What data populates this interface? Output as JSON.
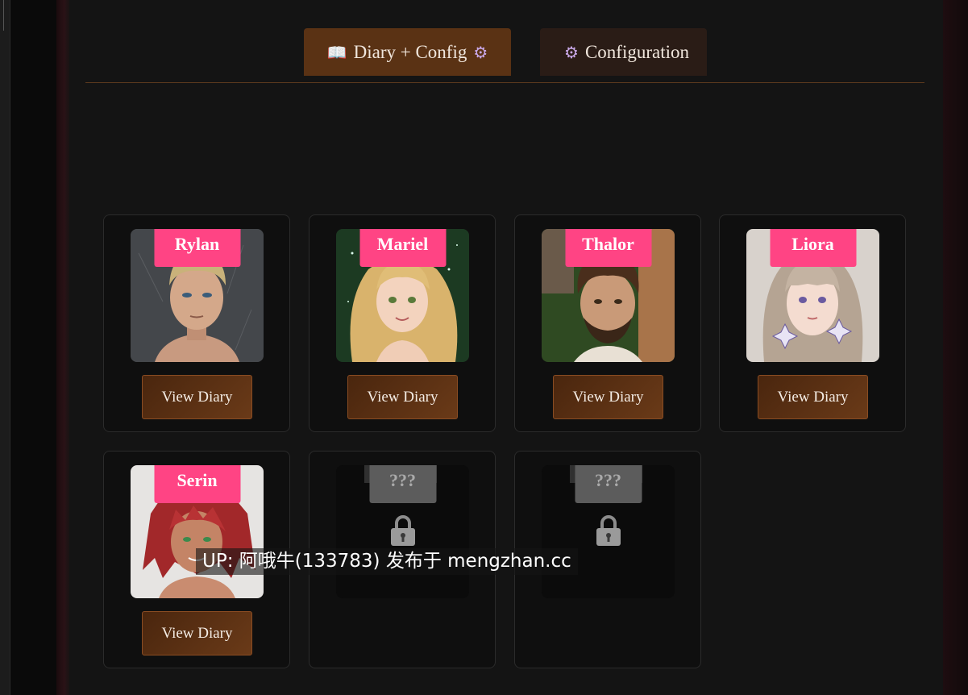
{
  "tabs": {
    "diary": {
      "icon_left": "📖",
      "label": "Diary + Config",
      "icon_right": "⚙",
      "active": true
    },
    "config": {
      "icon": "⚙",
      "label": "Configuration",
      "active": false
    }
  },
  "characters": [
    {
      "name": "Rylan",
      "button": "View Diary",
      "portrait": "blond-young-man-portrait"
    },
    {
      "name": "Mariel",
      "button": "View Diary",
      "portrait": "blonde-woman-portrait"
    },
    {
      "name": "Thalor",
      "button": "View Diary",
      "portrait": "bearded-brown-haired-man-portrait"
    },
    {
      "name": "Liora",
      "button": "View Diary",
      "portrait": "ash-haired-woman-with-flowers-portrait"
    },
    {
      "name": "Serin",
      "button": "View Diary",
      "portrait": "red-haired-woman-portrait"
    }
  ],
  "locked": [
    {
      "name": "???",
      "icon": "lock-icon"
    },
    {
      "name": "???",
      "icon": "lock-icon"
    }
  ],
  "watermark": "UP: 阿哦牛(133783) 发布于 mengzhan.cc",
  "colors": {
    "accent_tag": "#ff4484",
    "button_brown": "#5a3214",
    "panel": "#141414"
  }
}
